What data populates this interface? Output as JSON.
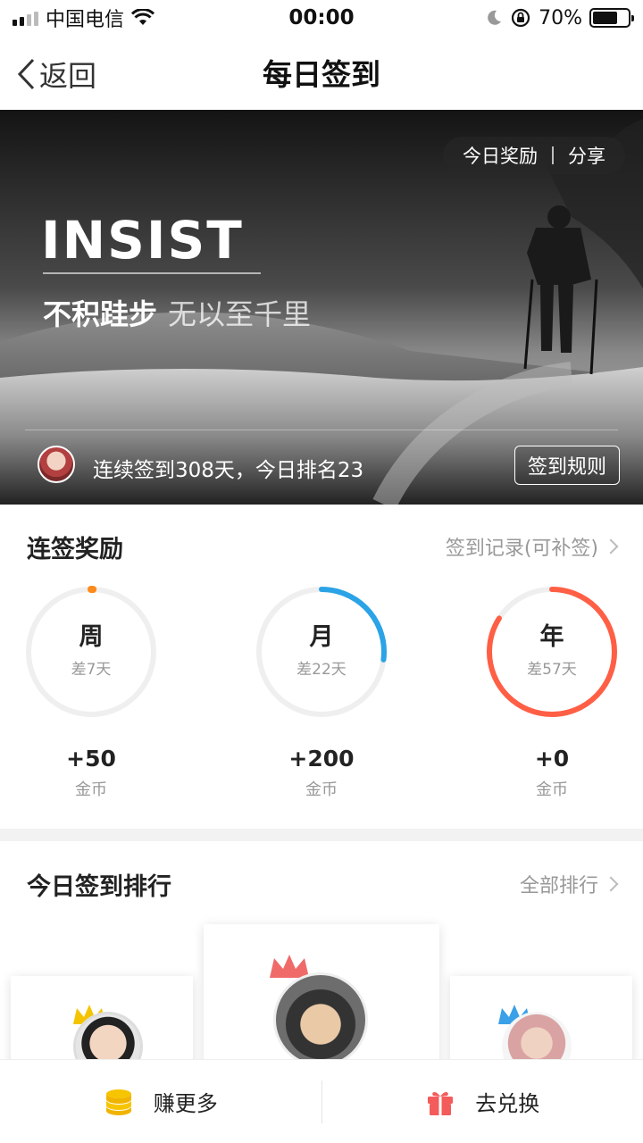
{
  "status_bar": {
    "carrier": "中国电信",
    "time": "00:00",
    "battery": "70%"
  },
  "nav": {
    "back_label": "返回",
    "title": "每日签到"
  },
  "banner": {
    "today_reward": "今日奖励",
    "share": "分享",
    "headline": "INSIST",
    "slogan_bold": "不积跬步",
    "slogan_thin": "无以至千里",
    "streak_text": "连续签到308天，今日排名23",
    "rules_button": "签到规则"
  },
  "streak": {
    "title": "连签奖励",
    "record_link": "签到记录(可补签)",
    "rings": [
      {
        "label": "周",
        "diff": "差7天",
        "reward": "+50",
        "unit": "金币",
        "progress": 0,
        "color": "#ff8a1c"
      },
      {
        "label": "月",
        "diff": "差22天",
        "reward": "+200",
        "unit": "金币",
        "progress": 0.27,
        "color": "#2ba3e6"
      },
      {
        "label": "年",
        "diff": "差57天",
        "reward": "+0",
        "unit": "金币",
        "progress": 0.84,
        "color": "#ff5f45"
      }
    ]
  },
  "ranking": {
    "title": "今日签到排行",
    "all_link": "全部排行"
  },
  "bottom_bar": {
    "earn_more": "赚更多",
    "redeem": "去兑换"
  },
  "colors": {
    "accent_orange": "#ff8a1c",
    "accent_blue": "#2ba3e6",
    "accent_red": "#ff5f45",
    "coin_yellow": "#f7c400",
    "gift_red": "#f45b5b"
  }
}
